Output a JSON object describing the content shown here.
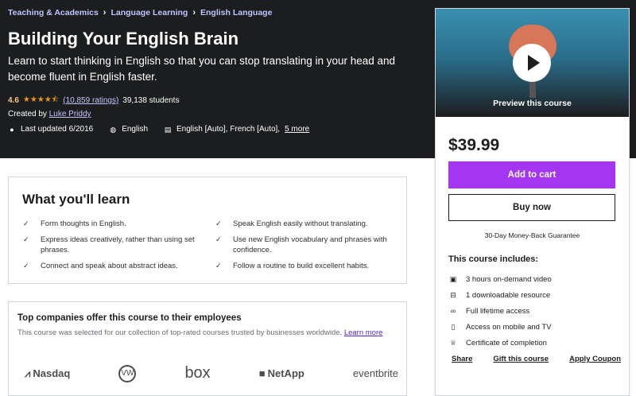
{
  "breadcrumb": [
    "Teaching & Academics",
    "Language Learning",
    "English Language"
  ],
  "course": {
    "title": "Building Your English Brain",
    "subtitle": "Learn to start thinking in English so that you can stop translating in your head and become fluent in English faster.",
    "rating": "4.6",
    "stars": "★★★★⯪",
    "ratings_count": "(10,859 ratings)",
    "students": "39,138 students",
    "created_by_label": "Created by",
    "instructor": "Luke Priddy",
    "last_updated": "Last updated 6/2016",
    "language": "English",
    "captions": "English [Auto], French [Auto],",
    "captions_more": "5 more"
  },
  "sidebar": {
    "preview_label": "Preview this course",
    "price": "$39.99",
    "add_to_cart": "Add to cart",
    "buy_now": "Buy now",
    "guarantee": "30-Day Money-Back Guarantee",
    "includes_title": "This course includes:",
    "includes": [
      {
        "icon": "video-icon",
        "text": "3 hours on-demand video"
      },
      {
        "icon": "file-icon",
        "text": "1 downloadable resource"
      },
      {
        "icon": "infinity-icon",
        "text": "Full lifetime access"
      },
      {
        "icon": "mobile-icon",
        "text": "Access on mobile and TV"
      },
      {
        "icon": "trophy-icon",
        "text": "Certificate of completion"
      }
    ],
    "share": "Share",
    "gift": "Gift this course",
    "coupon": "Apply Coupon"
  },
  "learn": {
    "title": "What you'll learn",
    "left": [
      "Form thoughts in English.",
      "Express ideas creatively, rather than using set phrases.",
      "Connect and speak about abstract ideas."
    ],
    "right": [
      "Speak English easily without translating.",
      "Use new English vocabulary and phrases with confidence.",
      "Follow a routine to build excellent habits."
    ]
  },
  "companies": {
    "title": "Top companies offer this course to their employees",
    "desc": "This course was selected for our collection of top-rated courses trusted by businesses worldwide.",
    "learn_more": "Learn more",
    "logos": [
      "Nasdaq",
      "VW",
      "box",
      "NetApp",
      "eventbrite"
    ]
  },
  "colors": {
    "accent": "#a435f0",
    "hero_bg": "#1c1d1f",
    "link": "#c0c4fc",
    "star": "#e59819"
  }
}
